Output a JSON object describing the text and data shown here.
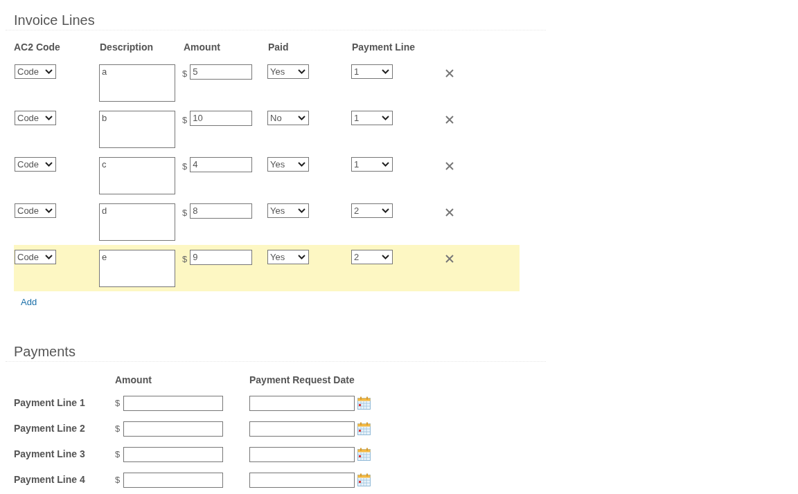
{
  "invoice_lines": {
    "title": "Invoice Lines",
    "columns": [
      "AC2 Code",
      "Description",
      "Amount",
      "Paid",
      "Payment Line"
    ],
    "rows": [
      {
        "code": "Code",
        "description": "a",
        "currency": "$",
        "amount": "5",
        "paid": "Yes",
        "payment_line": "1",
        "highlighted": false
      },
      {
        "code": "Code",
        "description": "b",
        "currency": "$",
        "amount": "10",
        "paid": "No",
        "payment_line": "1",
        "highlighted": false
      },
      {
        "code": "Code",
        "description": "c",
        "currency": "$",
        "amount": "4",
        "paid": "Yes",
        "payment_line": "1",
        "highlighted": false
      },
      {
        "code": "Code",
        "description": "d",
        "currency": "$",
        "amount": "8",
        "paid": "Yes",
        "payment_line": "2",
        "highlighted": false
      },
      {
        "code": "Code",
        "description": "e",
        "currency": "$",
        "amount": "9",
        "paid": "Yes",
        "payment_line": "2",
        "highlighted": true
      }
    ],
    "add_link": "Add"
  },
  "payments": {
    "title": "Payments",
    "columns": [
      "Amount",
      "Payment Request Date"
    ],
    "rows": [
      {
        "label": "Payment Line 1",
        "currency": "$"
      },
      {
        "label": "Payment Line 2",
        "currency": "$"
      },
      {
        "label": "Payment Line 3",
        "currency": "$"
      },
      {
        "label": "Payment Line 4",
        "currency": "$"
      }
    ]
  }
}
